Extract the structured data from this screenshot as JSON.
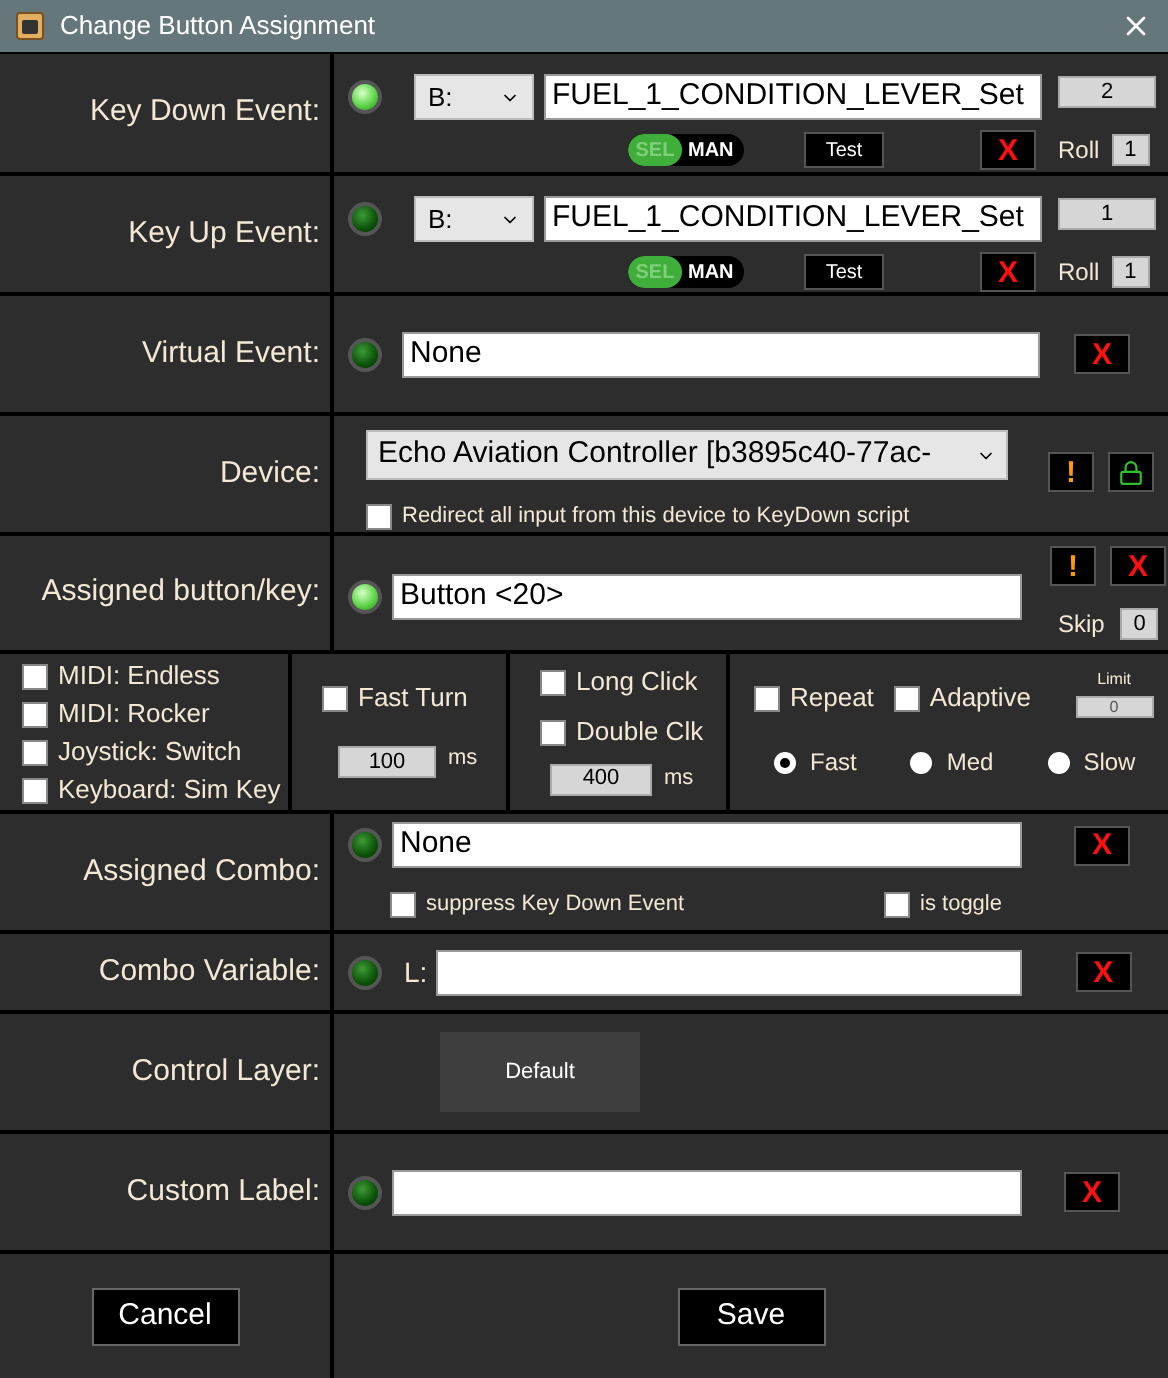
{
  "window": {
    "title": "Change Button Assignment"
  },
  "key_down": {
    "label": "Key Down Event:",
    "lit": true,
    "prefix": "B:",
    "event": "FUEL_1_CONDITION_LEVER_Set",
    "count": "2",
    "toggle": {
      "off_text": "SEL",
      "on_text": "MAN",
      "on": true
    },
    "test": "Test",
    "clear": "X",
    "roll_label": "Roll",
    "roll": "1"
  },
  "key_up": {
    "label": "Key Up Event:",
    "lit": false,
    "prefix": "B:",
    "event": "FUEL_1_CONDITION_LEVER_Set",
    "count": "1",
    "toggle": {
      "off_text": "SEL",
      "on_text": "MAN",
      "on": true
    },
    "test": "Test",
    "clear": "X",
    "roll_label": "Roll",
    "roll": "1"
  },
  "virtual": {
    "label": "Virtual Event:",
    "lit": false,
    "value": "None",
    "clear": "X"
  },
  "device": {
    "label": "Device:",
    "value": "Echo Aviation Controller [b3895c40-77ac-",
    "warn": "!",
    "redirect": {
      "label": "Redirect all input from this device to KeyDown script",
      "checked": false
    }
  },
  "assigned": {
    "label": "Assigned button/key:",
    "lit": true,
    "value": "Button <20>",
    "warn": "!",
    "clear": "X",
    "skip_label": "Skip",
    "skip": "0"
  },
  "options": {
    "types": [
      {
        "label": "MIDI: Endless",
        "checked": false
      },
      {
        "label": "MIDI: Rocker",
        "checked": false
      },
      {
        "label": "Joystick: Switch",
        "checked": false
      },
      {
        "label": "Keyboard: Sim Key",
        "checked": false
      }
    ],
    "fast_turn": {
      "label": "Fast Turn",
      "checked": false,
      "ms": "100",
      "unit": "ms"
    },
    "clicks": [
      {
        "label": "Long Click",
        "checked": false
      },
      {
        "label": "Double Clk",
        "checked": false
      }
    ],
    "click_ms": "400",
    "click_unit": "ms",
    "repeat": {
      "label": "Repeat",
      "checked": false
    },
    "adaptive": {
      "label": "Adaptive",
      "checked": false
    },
    "limit_label": "Limit",
    "limit": "0",
    "speeds": [
      {
        "label": "Fast",
        "selected": true
      },
      {
        "label": "Med",
        "selected": false
      },
      {
        "label": "Slow",
        "selected": false
      }
    ]
  },
  "combo": {
    "label": "Assigned Combo:",
    "lit": false,
    "value": "None",
    "clear": "X",
    "suppress": {
      "label": "suppress Key Down Event",
      "checked": false
    },
    "is_toggle": {
      "label": "is toggle",
      "checked": false
    }
  },
  "combo_var": {
    "label": "Combo Variable:",
    "lit": false,
    "prefix": "L:",
    "clear": "X"
  },
  "layer": {
    "label": "Control Layer:",
    "button": "Default"
  },
  "custom": {
    "label": "Custom Label:",
    "lit": false,
    "clear": "X"
  },
  "footer": {
    "cancel": "Cancel",
    "save": "Save"
  }
}
